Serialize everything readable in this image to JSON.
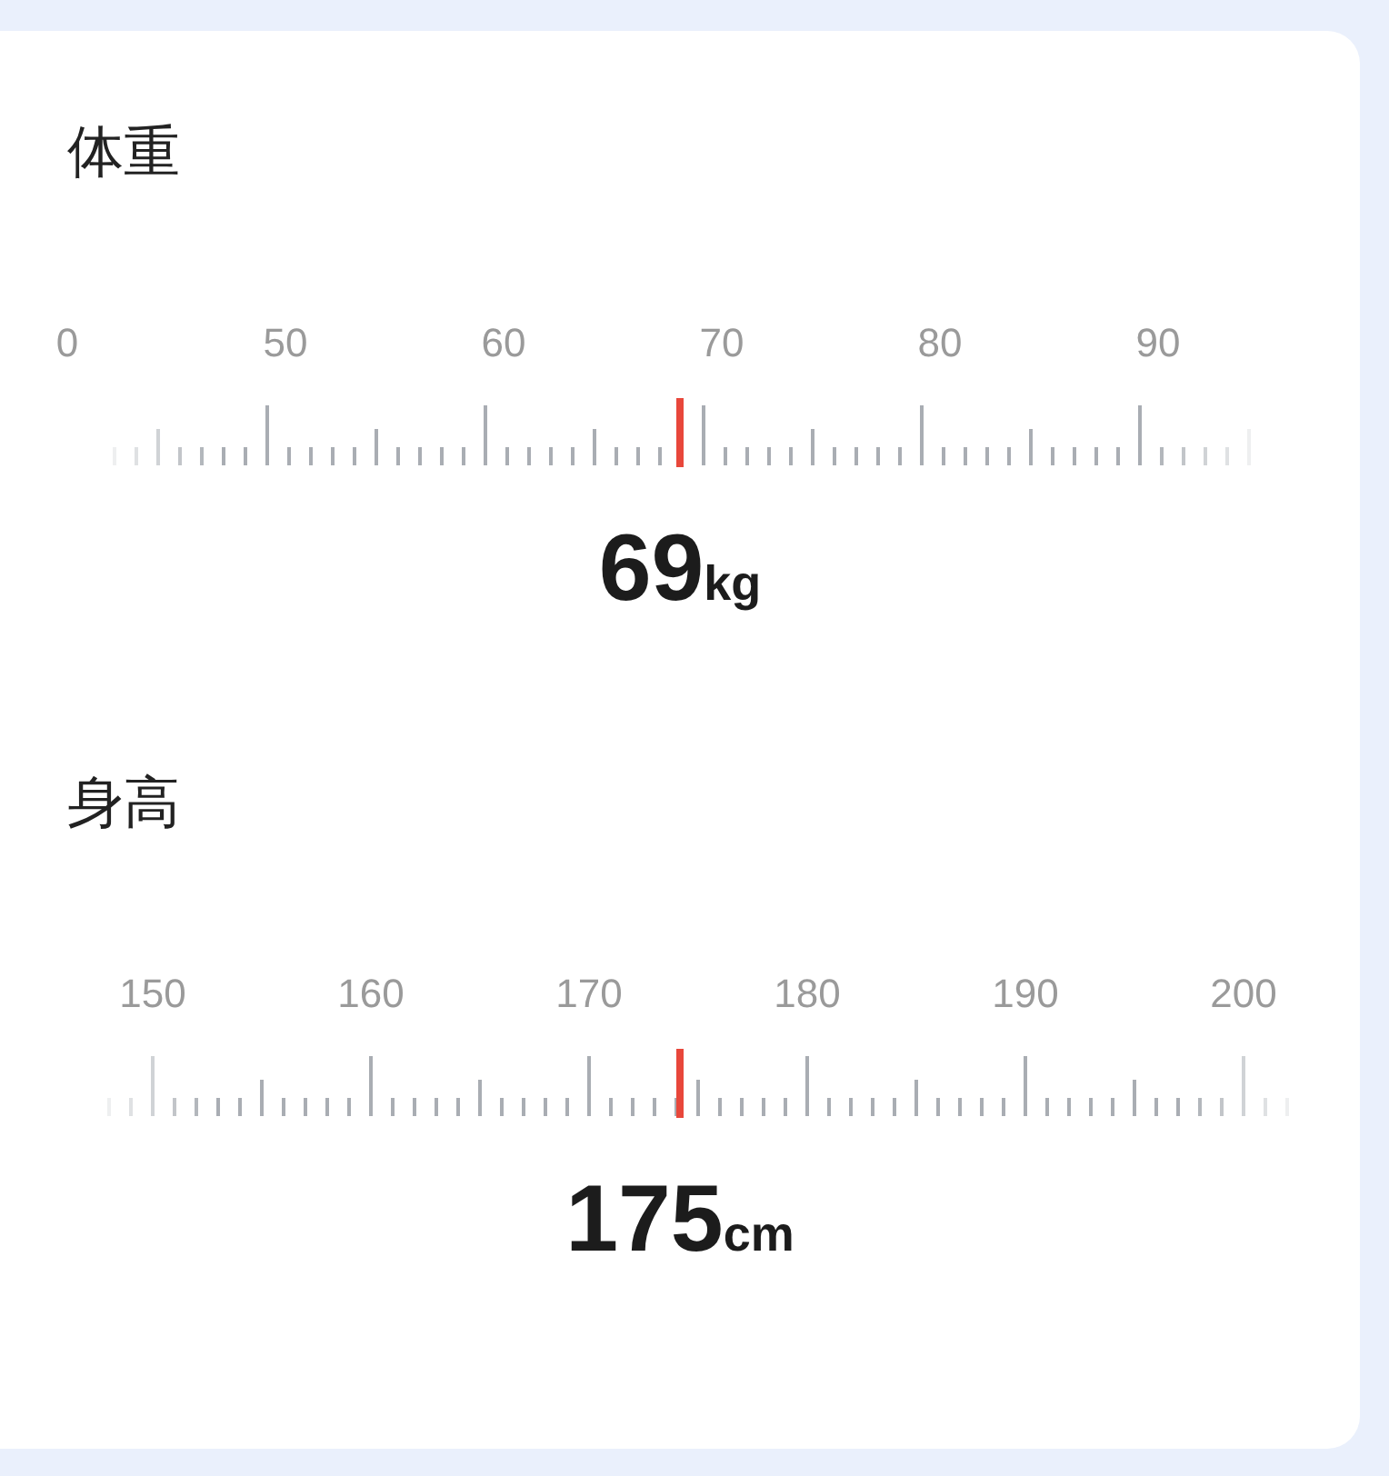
{
  "sections": [
    {
      "title": "体重",
      "scale_labels": [
        "0",
        "50",
        "60",
        "70",
        "80",
        "90"
      ],
      "value": "69",
      "unit": "kg"
    },
    {
      "title": "身高",
      "scale_labels": [
        "150",
        "160",
        "170",
        "180",
        "190",
        "200"
      ],
      "value": "175",
      "unit": "cm"
    }
  ]
}
